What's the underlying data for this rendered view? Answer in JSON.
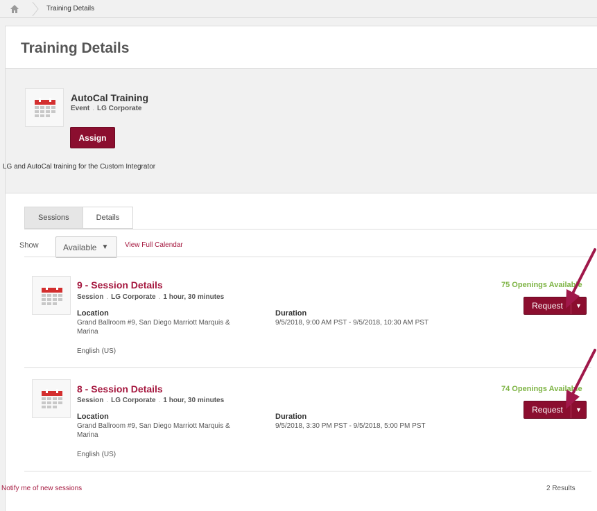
{
  "breadcrumb": {
    "home_icon": "home-icon",
    "current": "Training Details"
  },
  "page": {
    "title": "Training Details"
  },
  "course": {
    "title": "AutoCal Training",
    "type": "Event",
    "provider": "LG Corporate",
    "assign_label": "Assign",
    "description": "LG and AutoCal training for the Custom Integrator",
    "icon": "calendar-icon"
  },
  "tabs": [
    {
      "label": "Sessions",
      "active": true
    },
    {
      "label": "Details",
      "active": false
    }
  ],
  "filter": {
    "show_label": "Show",
    "selected": "Available",
    "calendar_link": "View Full Calendar"
  },
  "sessions": [
    {
      "title": "9 - Session Details",
      "type": "Session",
      "provider": "LG Corporate",
      "length": "1 hour, 30 minutes",
      "location_label": "Location",
      "location_line1": "Grand Ballroom #9, San Diego Marriott Marquis &",
      "location_line2": "Marina",
      "language": "English (US)",
      "duration_label": "Duration",
      "duration": "9/5/2018, 9:00 AM PST - 9/5/2018, 10:30 AM PST",
      "openings": "75 Openings Available",
      "request_label": "Request"
    },
    {
      "title": "8 - Session Details",
      "type": "Session",
      "provider": "LG Corporate",
      "length": "1 hour, 30 minutes",
      "location_label": "Location",
      "location_line1": "Grand Ballroom #9, San Diego Marriott Marquis &",
      "location_line2": "Marina",
      "language": "English (US)",
      "duration_label": "Duration",
      "duration": "9/5/2018, 3:30 PM PST - 9/5/2018, 5:00 PM PST",
      "openings": "74 Openings Available",
      "request_label": "Request"
    }
  ],
  "footer": {
    "notify_link": "Notify me of new sessions",
    "results": "2 Results"
  },
  "colors": {
    "brand": "#8b0e2f",
    "link": "#a5183f",
    "available": "#7cb342",
    "annotation_arrow": "#a0184a"
  }
}
